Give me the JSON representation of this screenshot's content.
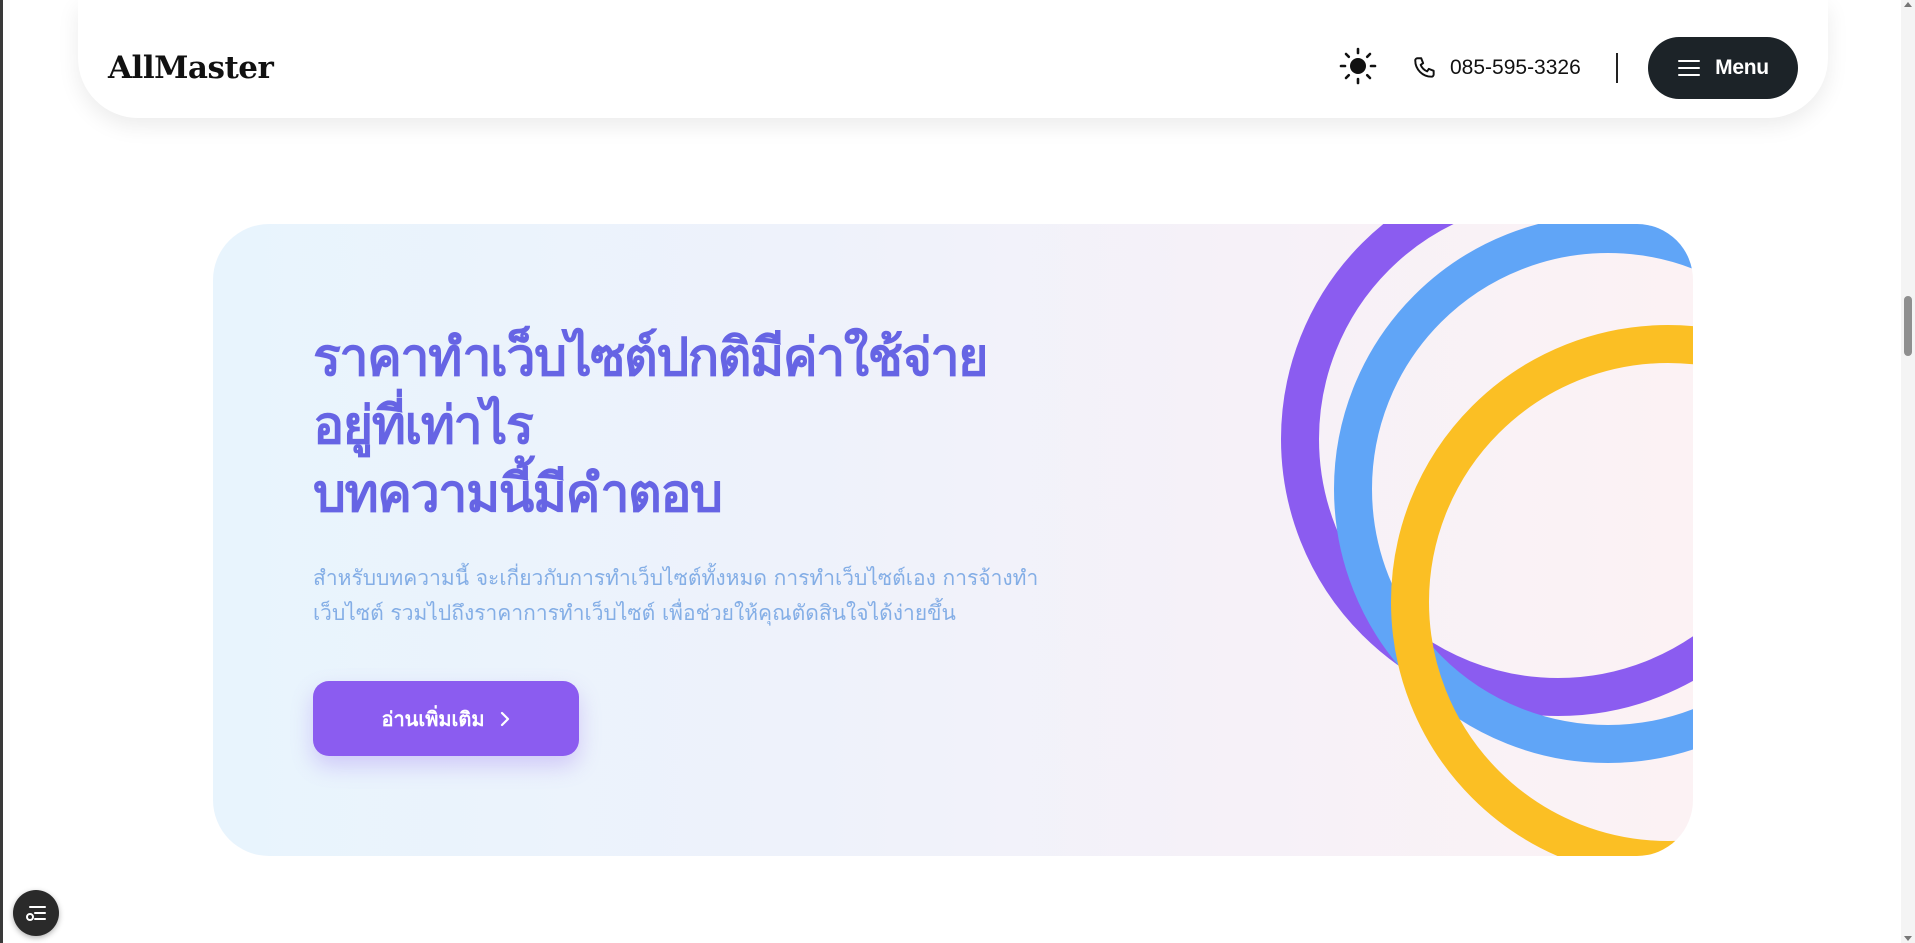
{
  "header": {
    "logo": "AllMaster",
    "theme_icon": "sun-icon",
    "phone_icon": "phone-icon",
    "phone_number": "085-595-3326",
    "menu_icon": "hamburger-icon",
    "menu_label": "Menu"
  },
  "hero": {
    "title_lines": [
      "ราคาทำเว็บไซต์ปกติมีค่าใช้จ่าย",
      "อยู่ที่เท่าไร",
      "บทความนี้มีคำตอบ"
    ],
    "description": "สำหรับบทความนี้ จะเกี่ยวกับการทำเว็บไซต์ทั้งหมด การทำเว็บไซต์เอง การจ้างทำเว็บไซต์ รวมไปถึงราคาการทำเว็บไซต์ เพื่อช่วยให้คุณตัดสินใจได้ง่ายขึ้น",
    "cta_label": "อ่านเพิ่มเติม",
    "cta_icon": "chevron-right-icon"
  },
  "floating": {
    "icon": "list-settings-icon"
  },
  "colors": {
    "title": "#6664e4",
    "description": "#84aee6",
    "cta": "#8b5cf0",
    "ring_purple": "#8b5cf0",
    "ring_blue": "#60a5f7",
    "ring_yellow": "#fbbf24",
    "menu_bg": "#1c2328"
  }
}
